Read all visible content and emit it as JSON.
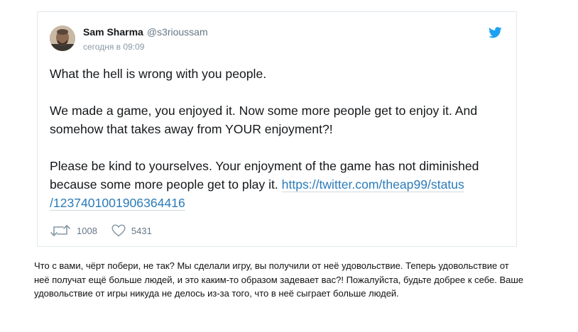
{
  "tweet": {
    "author": {
      "name": "Sam Sharma",
      "handle": "@s3rioussam",
      "timestamp": "сегодня в 09:09"
    },
    "paragraphs": [
      "What the hell is wrong with you people.",
      "We made a game, you enjoyed it. Now some more people get to enjoy it. And somehow that takes away from YOUR enjoyment?!",
      "Please be kind to yourselves. Your enjoyment of the game has not diminished because some more people get to play it. "
    ],
    "link_line1": "https://twitter.com/theap99/status",
    "link_line2": "/1237401001906364416",
    "retweets": "1008",
    "likes": "5431"
  },
  "caption": "Что с вами, чёрт побери, не так? Мы сделали игру, вы получили от неё удовольствие. Теперь удовольствие от неё получат ещё больше людей, и это каким-то образом задевает вас?! Пожалуйста, будьте добрее к себе. Ваше удовольствие от игры никуда не делось из-за того, что в неё сыграет больше людей.",
  "icons": {
    "brand": "twitter-bird-icon",
    "retweet": "retweet-icon",
    "like": "heart-icon"
  },
  "colors": {
    "twitter_blue": "#1da1f2",
    "link": "#2b7bb9",
    "muted": "#657786"
  }
}
